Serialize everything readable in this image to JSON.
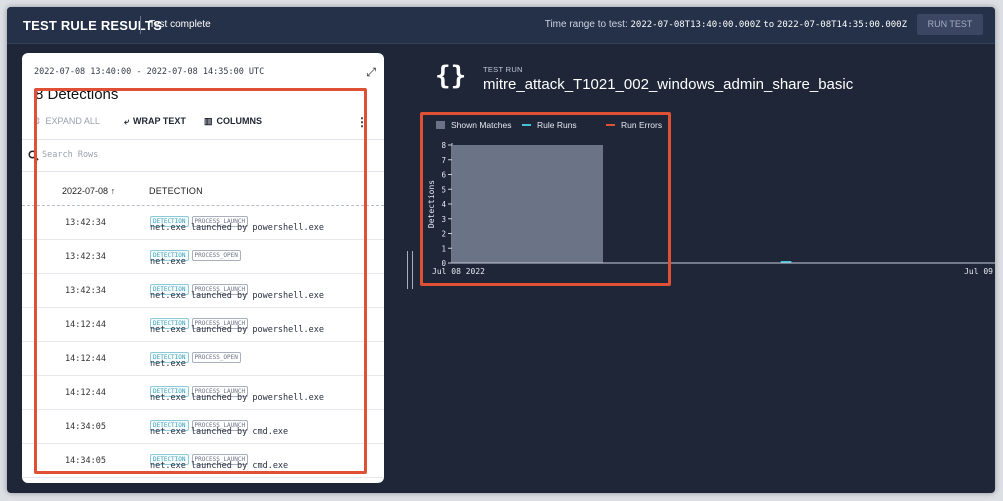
{
  "header": {
    "title": "TEST RULE RESULTS",
    "status": "Test complete",
    "range_label": "Time range to test:",
    "range_start": "2022-07-08T13:40:00.000Z",
    "range_to": "to",
    "range_end": "2022-07-08T14:35:00.000Z",
    "run_button": "RUN TEST"
  },
  "left_panel": {
    "range": "2022-07-08 13:40:00 - 2022-07-08 14:35:00 UTC",
    "count_title": "8 Detections",
    "toolbar": {
      "expand_all": "EXPAND ALL",
      "wrap_text": "WRAP TEXT",
      "columns": "COLUMNS"
    },
    "search_placeholder": "Search Rows",
    "columns": {
      "date": "2022-07-08",
      "date_sort": "↑",
      "detection": "DETECTION"
    },
    "rows": [
      {
        "time": "13:42:34",
        "badge1": "DETECTION",
        "badge2": "PROCESS_LAUNCH",
        "message": "net.exe launched by powershell.exe"
      },
      {
        "time": "13:42:34",
        "badge1": "DETECTION",
        "badge2": "PROCESS_OPEN",
        "message": "net.exe"
      },
      {
        "time": "13:42:34",
        "badge1": "DETECTION",
        "badge2": "PROCESS_LAUNCH",
        "message": "net.exe launched by powershell.exe"
      },
      {
        "time": "14:12:44",
        "badge1": "DETECTION",
        "badge2": "PROCESS_LAUNCH",
        "message": "net.exe launched by powershell.exe"
      },
      {
        "time": "14:12:44",
        "badge1": "DETECTION",
        "badge2": "PROCESS_OPEN",
        "message": "net.exe"
      },
      {
        "time": "14:12:44",
        "badge1": "DETECTION",
        "badge2": "PROCESS_LAUNCH",
        "message": "net.exe launched by powershell.exe"
      },
      {
        "time": "14:34:05",
        "badge1": "DETECTION",
        "badge2": "PROCESS_LAUNCH",
        "message": "net.exe launched by cmd.exe"
      },
      {
        "time": "14:34:05",
        "badge1": "DETECTION",
        "badge2": "PROCESS_LAUNCH",
        "message": "net.exe launched by cmd.exe"
      }
    ]
  },
  "test_run": {
    "label": "TEST RUN",
    "name": "mitre_attack_T1021_002_windows_admin_share_basic"
  },
  "chart_data": {
    "type": "bar",
    "legend": [
      {
        "name": "Shown Matches",
        "color": "#6b7387"
      },
      {
        "name": "Rule Runs",
        "color": "#45c2d8"
      },
      {
        "name": "Run Errors",
        "color": "#e05035"
      }
    ],
    "legend_placement": "top-left",
    "ylabel": "Detections",
    "ylim": [
      0,
      8
    ],
    "yticks": [
      0,
      1,
      2,
      3,
      4,
      5,
      6,
      7,
      8
    ],
    "xticks": [
      "Jul 08 2022",
      "Jul 09"
    ],
    "series": [
      {
        "name": "Shown Matches",
        "points": [
          {
            "x_start": "2022-07-08T00:00",
            "x_end": "2022-07-08T08:00",
            "y": 8
          }
        ]
      },
      {
        "name": "Rule Runs",
        "points": [
          {
            "x_start": "2022-07-08T14:00",
            "x_end": "2022-07-08T15:00",
            "y": 0
          }
        ]
      }
    ],
    "grid": false
  },
  "colors": {
    "background": "#1e2638",
    "header": "#253149",
    "highlight": "#e05035",
    "accent": "#45c2d8"
  }
}
